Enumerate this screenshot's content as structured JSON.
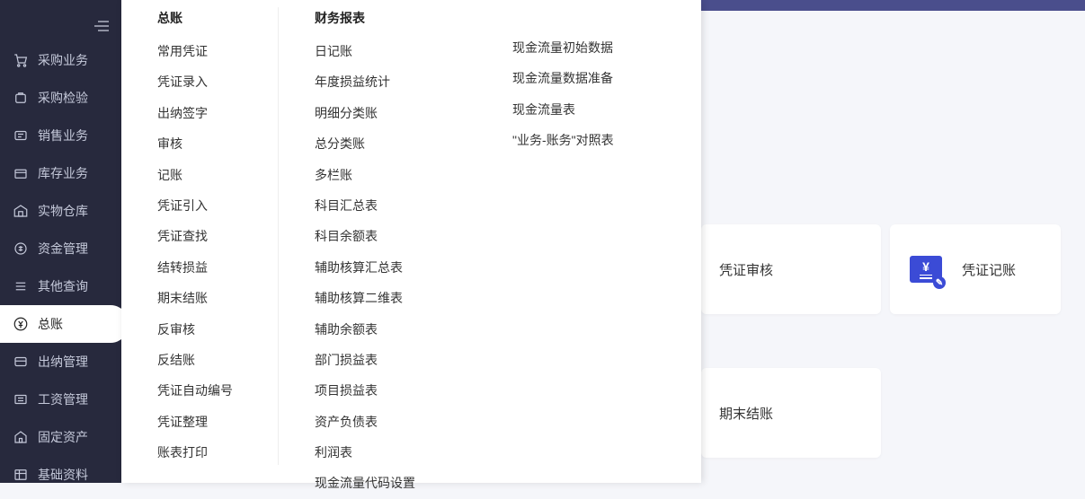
{
  "sidebar": {
    "items": [
      {
        "label": "采购业务"
      },
      {
        "label": "采购检验"
      },
      {
        "label": "销售业务"
      },
      {
        "label": "库存业务"
      },
      {
        "label": "实物仓库"
      },
      {
        "label": "资金管理"
      },
      {
        "label": "其他查询"
      },
      {
        "label": "总账"
      },
      {
        "label": "出纳管理"
      },
      {
        "label": "工资管理"
      },
      {
        "label": "固定资产"
      },
      {
        "label": "基础资料"
      }
    ]
  },
  "submenu": {
    "col1": {
      "heading": "总账",
      "items": [
        "常用凭证",
        "凭证录入",
        "出纳签字",
        "审核",
        "记账",
        "凭证引入",
        "凭证查找",
        "结转损益",
        "期末结账",
        "反审核",
        "反结账",
        "凭证自动编号",
        "凭证整理",
        "账表打印"
      ]
    },
    "col2": {
      "heading": "财务报表",
      "items": [
        "日记账",
        "年度损益统计",
        "明细分类账",
        "总分类账",
        "多栏账",
        "科目汇总表",
        "科目余额表",
        "辅助核算汇总表",
        "辅助核算二维表",
        "辅助余额表",
        "部门损益表",
        "项目损益表",
        "资产负债表",
        "利润表",
        "现金流量代码设置"
      ]
    },
    "col3": {
      "items": [
        "现金流量初始数据",
        "现金流量数据准备",
        "现金流量表",
        "\"业务-账务\"对照表"
      ]
    }
  },
  "cards": {
    "audit": "凭证审核",
    "post": "凭证记账",
    "close": "期末结账"
  }
}
